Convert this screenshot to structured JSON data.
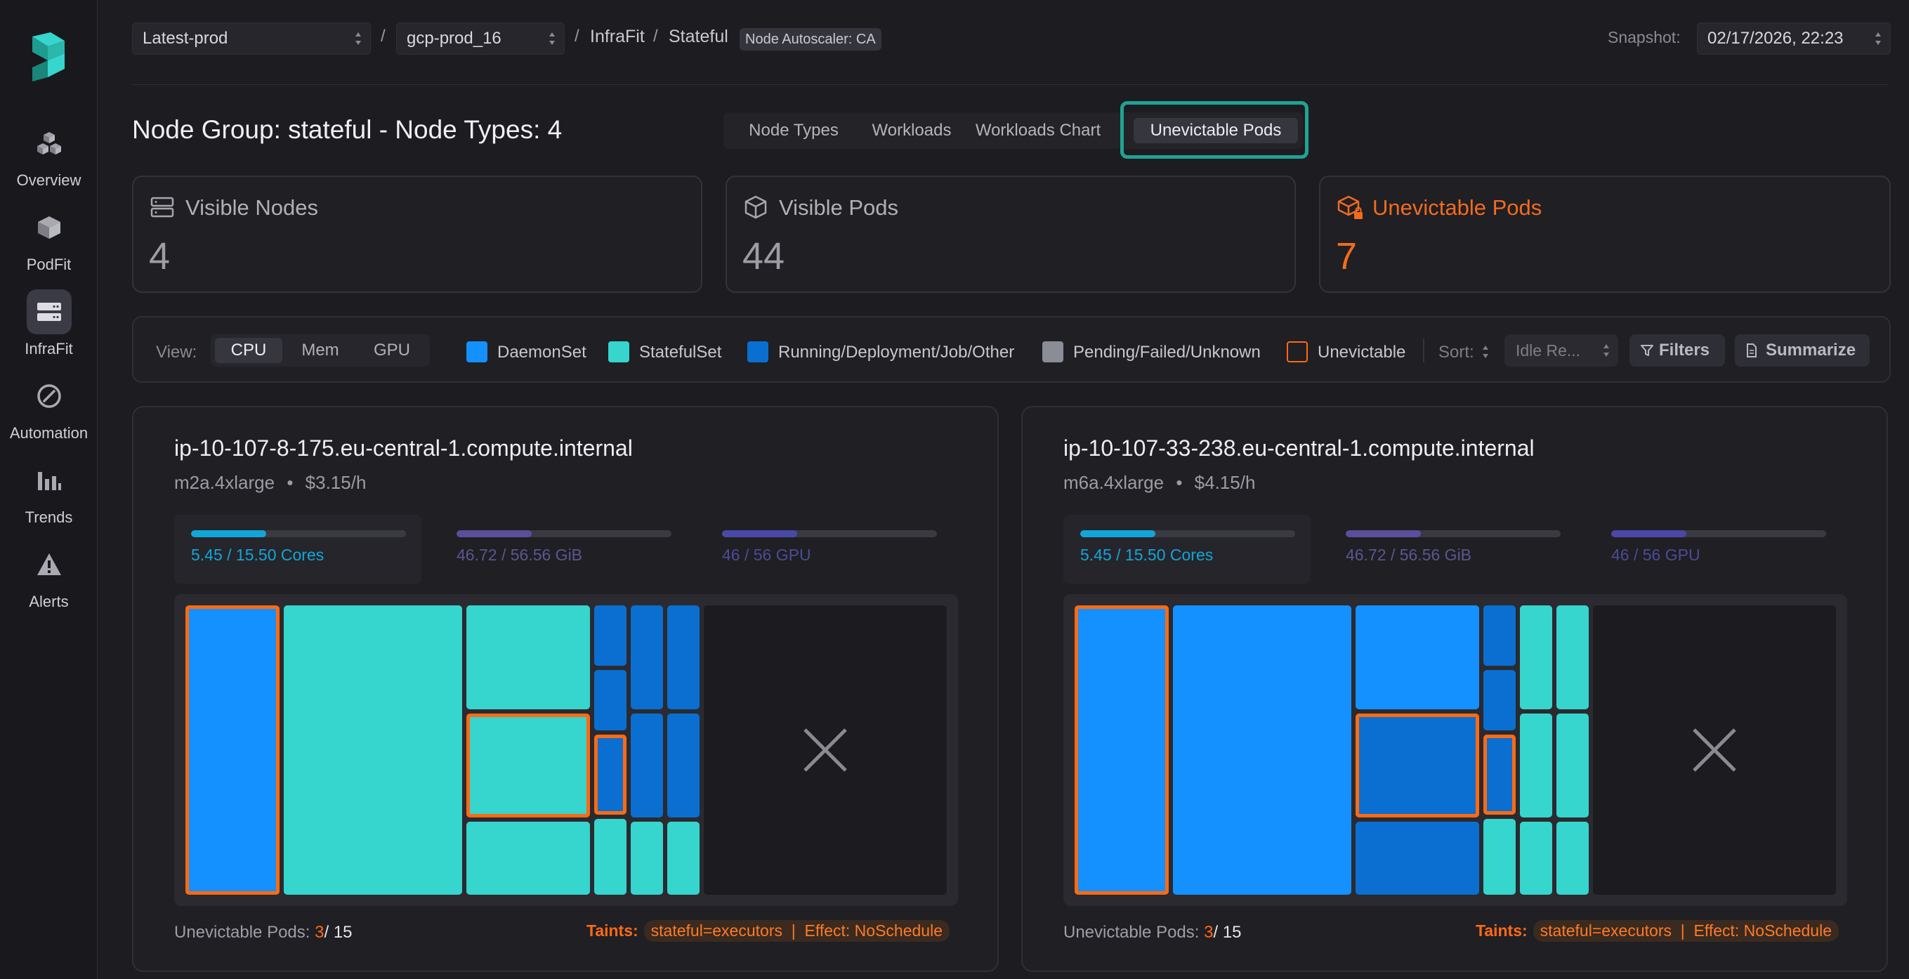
{
  "sidebar": {
    "items": [
      {
        "label": "Overview",
        "icon": "cubes-icon"
      },
      {
        "label": "PodFit",
        "icon": "cube-icon"
      },
      {
        "label": "InfraFit",
        "icon": "server-icon",
        "active": true
      },
      {
        "label": "Automation",
        "icon": "compass-icon"
      },
      {
        "label": "Trends",
        "icon": "bar-chart-icon"
      },
      {
        "label": "Alerts",
        "icon": "warning-icon"
      }
    ]
  },
  "topbar": {
    "env_select": "Latest-prod",
    "cluster_select": "gcp-prod_16",
    "sep": "/",
    "crumb_infrafit": "InfraFit",
    "crumb_stateful": "Stateful",
    "badge": "Node Autoscaler: CA",
    "snapshot_label": "Snapshot:",
    "snapshot_value": "02/17/2026, 22:23"
  },
  "page_title": "Node Group: stateful - Node Types: 4",
  "tabs": [
    "Node Types",
    "Workloads",
    "Workloads Chart",
    "Unevictable Pods"
  ],
  "active_tab": "Unevictable Pods",
  "stats": {
    "nodes_label": "Visible Nodes",
    "nodes_value": "4",
    "pods_label": "Visible Pods",
    "pods_value": "44",
    "unevictable_label": "Unevictable Pods",
    "unevictable_value": "7"
  },
  "filters": {
    "view_label": "View:",
    "views": [
      "CPU",
      "Mem",
      "GPU"
    ],
    "active_view": "CPU",
    "legend": [
      {
        "label": "DaemonSet",
        "color": "#1590ff"
      },
      {
        "label": "StatefulSet",
        "color": "#36d5ce"
      },
      {
        "label": "Running/Deployment/Job/Other",
        "color": "#0a6fd0"
      },
      {
        "label": "Pending/Failed/Unknown",
        "color": "#8a8d96"
      },
      {
        "label": "Unevictable",
        "color": "#ff6a13"
      }
    ],
    "sort_label": "Sort:",
    "sort_value": "Idle Re...",
    "filters_button": "Filters",
    "summarize_button": "Summarize"
  },
  "nodes": [
    {
      "name": "ip-10-107-8-175.eu-central-1.compute.internal",
      "instance": "m2a.4xlarge",
      "dot": "•",
      "price": "$3.15/h",
      "cpu": "5.45 / 15.50 Cores",
      "cpu_frac": 0.35,
      "mem": "46.72 / 56.56 GiB",
      "mem_frac": 0.35,
      "gpu": "46 / 56 GPU",
      "gpu_frac": 0.35,
      "unevictable_label": "Unevictable Pods:",
      "unevictable_count": "3",
      "total_pods": "/ 15",
      "taints_label": "Taints:",
      "taints_value": "stateful=executors  |  Effect: NoSchedule"
    },
    {
      "name": "ip-10-107-33-238.eu-central-1.compute.internal",
      "instance": "m6a.4xlarge",
      "dot": "•",
      "price": "$4.15/h",
      "cpu": "5.45 / 15.50 Cores",
      "cpu_frac": 0.35,
      "mem": "46.72 / 56.56 GiB",
      "mem_frac": 0.35,
      "gpu": "46 / 56 GPU",
      "gpu_frac": 0.35,
      "unevictable_label": "Unevictable Pods:",
      "unevictable_count": "3",
      "total_pods": "/ 15",
      "taints_label": "Taints:",
      "taints_value": "stateful=executors  |  Effect: NoSchedule"
    }
  ],
  "colors": {
    "accent_teal": "#20a393",
    "unevictable": "#ff6a13",
    "daemonset": "#1590ff",
    "statefulset": "#36d5ce",
    "running": "#0a6fd0",
    "cpu_bar": "#12a6d8",
    "mem_bar": "#5b4e9c",
    "gpu_bar": "#4a49a8"
  }
}
